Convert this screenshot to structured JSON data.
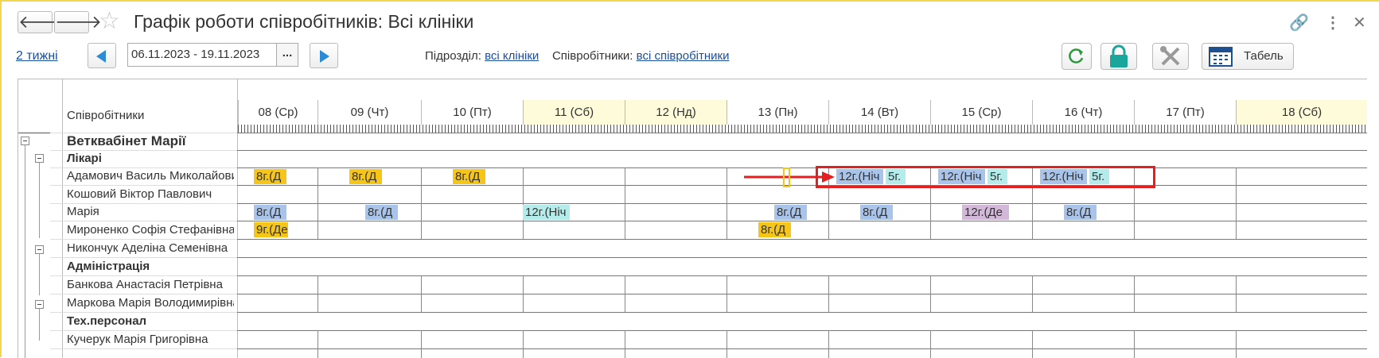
{
  "window": {
    "title": "Графік роботи співробітників: Всі клініки",
    "back_glyph": "🡐",
    "forward_glyph": "🡒",
    "star_glyph": "☆",
    "link_glyph": "🔗",
    "more_glyph": "⋮",
    "close_glyph": "✕"
  },
  "toolbar": {
    "period_link": "2 тижні",
    "date_range": "06.11.2023 - 19.11.2023",
    "dots": "...",
    "subdivision_label": "Підрозділ:",
    "subdivision_value": "всі клініки",
    "employees_label": "Співробітники:",
    "employees_value": "всі співробітники",
    "tabel_label": "Табель",
    "icons": [
      "refresh-icon",
      "lock-icon",
      "tools-icon",
      "calendar-icon"
    ]
  },
  "grid": {
    "employees_header": "Співробітники",
    "days": [
      {
        "label": "08 (Ср)",
        "weekend": false
      },
      {
        "label": "09 (Чт)",
        "weekend": false
      },
      {
        "label": "10 (Пт)",
        "weekend": false
      },
      {
        "label": "11 (Сб)",
        "weekend": true
      },
      {
        "label": "12 (Нд)",
        "weekend": true
      },
      {
        "label": "13 (Пн)",
        "weekend": false
      },
      {
        "label": "14 (Вт)",
        "weekend": false
      },
      {
        "label": "15 (Ср)",
        "weekend": false
      },
      {
        "label": "16 (Чт)",
        "weekend": false
      },
      {
        "label": "17 (Пт)",
        "weekend": false
      },
      {
        "label": "18 (Сб)",
        "weekend": true
      }
    ],
    "clinic": "Ветквабінет Марії",
    "groups": {
      "doctors": "Лікарі",
      "admin": "Адміністрація",
      "tech": "Тех.персонал"
    },
    "employees": {
      "adamovych": "Адамович Василь Миколайович",
      "koshovyi": "Кошовий Віктор Павлович",
      "mariia": "Марія",
      "myronenko": "Мироненко Софія Стефанівна",
      "nykonchuk": "Никончук Аделіна Семенівна",
      "bankova": "Банкова Анастасія Петрівна",
      "markova": "Маркова Марія Володимирівна",
      "kucheruk": "Кучерук Марія Григорівна"
    },
    "colors": {
      "day_shift": "#f5c518",
      "blue_shift": "#a9c4ea",
      "cyan_shift": "#b3ecea",
      "purple_shift": "#d4b8d9",
      "weekend_header": "#fdfbd9",
      "highlight": "#e32020"
    },
    "shifts": {
      "adamovych": [
        {
          "day": 0,
          "text": "8г.(Д",
          "kind": "day_shift"
        },
        {
          "day": 1,
          "text": "8г.(Д",
          "kind": "day_shift"
        },
        {
          "day": 2,
          "text": "8г.(Д",
          "kind": "day_shift"
        },
        {
          "day": 6,
          "text": "12г.(Ніч",
          "kind": "blue_shift"
        },
        {
          "day": 6,
          "text": "5г.",
          "kind": "cyan_shift"
        },
        {
          "day": 7,
          "text": "12г.(Ніч",
          "kind": "blue_shift"
        },
        {
          "day": 7,
          "text": "5г.",
          "kind": "cyan_shift"
        },
        {
          "day": 8,
          "text": "12г.(Ніч",
          "kind": "blue_shift"
        },
        {
          "day": 8,
          "text": "5г.",
          "kind": "cyan_shift"
        }
      ],
      "mariia": [
        {
          "day": 0,
          "text": "8г.(Д",
          "kind": "blue_shift"
        },
        {
          "day": 1,
          "text": "8г.(Д",
          "kind": "blue_shift"
        },
        {
          "day": 3,
          "text": "12г.(Ніч",
          "kind": "cyan_shift"
        },
        {
          "day": 5,
          "text": "8г.(Д",
          "kind": "blue_shift"
        },
        {
          "day": 6,
          "text": "8г.(Д",
          "kind": "blue_shift"
        },
        {
          "day": 7,
          "text": "12г.(Де",
          "kind": "purple_shift"
        },
        {
          "day": 8,
          "text": "8г.(Д",
          "kind": "blue_shift"
        }
      ],
      "myronenko": [
        {
          "day": 0,
          "text": "9г.(Де",
          "kind": "day_shift"
        },
        {
          "day": 5,
          "text": "8г.(Д",
          "kind": "day_shift"
        }
      ]
    }
  }
}
